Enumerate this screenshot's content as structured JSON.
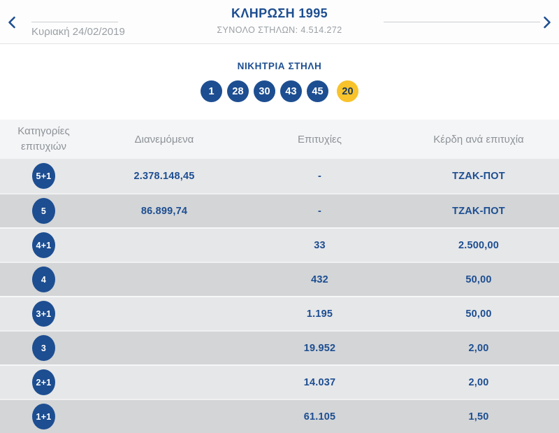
{
  "header": {
    "date": "Κυριακή 24/02/2019",
    "title": "ΚΛΗΡΩΣΗ 1995",
    "total_columns_label": "ΣΥΝΟΛΟ ΣΤΗΛΩΝ: 4.514.272"
  },
  "winning": {
    "label": "ΝΙΚΗΤΡΙΑ ΣΤΗΛΗ",
    "numbers": [
      "1",
      "28",
      "30",
      "43",
      "45"
    ],
    "joker": "20"
  },
  "table": {
    "headers": {
      "category": "Κατηγορίες επιτυχιών",
      "distributed": "Διανεμόμενα",
      "wins": "Επιτυχίες",
      "prize": "Κέρδη ανά επιτυχία"
    },
    "rows": [
      {
        "category": "5+1",
        "distributed": "2.378.148,45",
        "wins": "-",
        "prize": "ΤΖΑΚ-ΠΟΤ"
      },
      {
        "category": "5",
        "distributed": "86.899,74",
        "wins": "-",
        "prize": "ΤΖΑΚ-ΠΟΤ"
      },
      {
        "category": "4+1",
        "distributed": "",
        "wins": "33",
        "prize": "2.500,00"
      },
      {
        "category": "4",
        "distributed": "",
        "wins": "432",
        "prize": "50,00"
      },
      {
        "category": "3+1",
        "distributed": "",
        "wins": "1.195",
        "prize": "50,00"
      },
      {
        "category": "3",
        "distributed": "",
        "wins": "19.952",
        "prize": "2,00"
      },
      {
        "category": "2+1",
        "distributed": "",
        "wins": "14.037",
        "prize": "2,00"
      },
      {
        "category": "1+1",
        "distributed": "",
        "wins": "61.105",
        "prize": "1,50"
      }
    ]
  },
  "colors": {
    "navy": "#1d4e91",
    "joker_yellow": "#f8c32b",
    "row_light": "#e6e7e9",
    "row_dark": "#d3d5d7",
    "header_row_bg": "#f4f5f6",
    "muted": "#9aa0a5",
    "line": "#c9ced4"
  }
}
